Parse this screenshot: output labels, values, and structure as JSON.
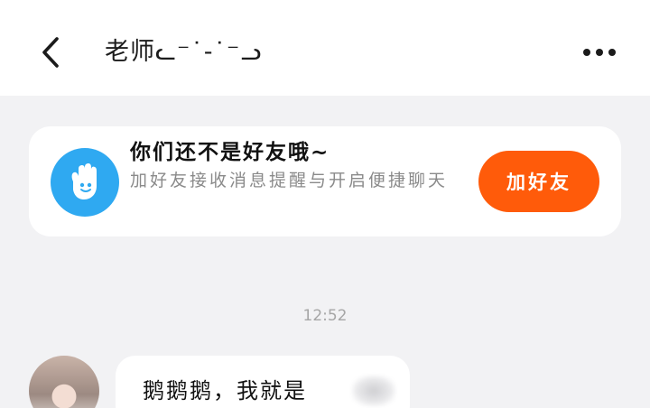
{
  "header": {
    "title": "老师ᓚ⁻˙-˙⁻ᓗ",
    "back_icon": "chevron-left-icon",
    "more_icon": "more-horizontal-icon"
  },
  "friend_prompt": {
    "icon": "hand-wave-icon",
    "icon_color": "#2fa9f1",
    "title": "你们还不是好友哦~",
    "subtitle": "加好友接收消息提醒与开启便捷聊天",
    "button_label": "加好友",
    "button_color": "#ff5b0a"
  },
  "messages": [
    {
      "timestamp": "12:52",
      "sender": "other",
      "text": "鹅鹅鹅，我就是"
    }
  ]
}
